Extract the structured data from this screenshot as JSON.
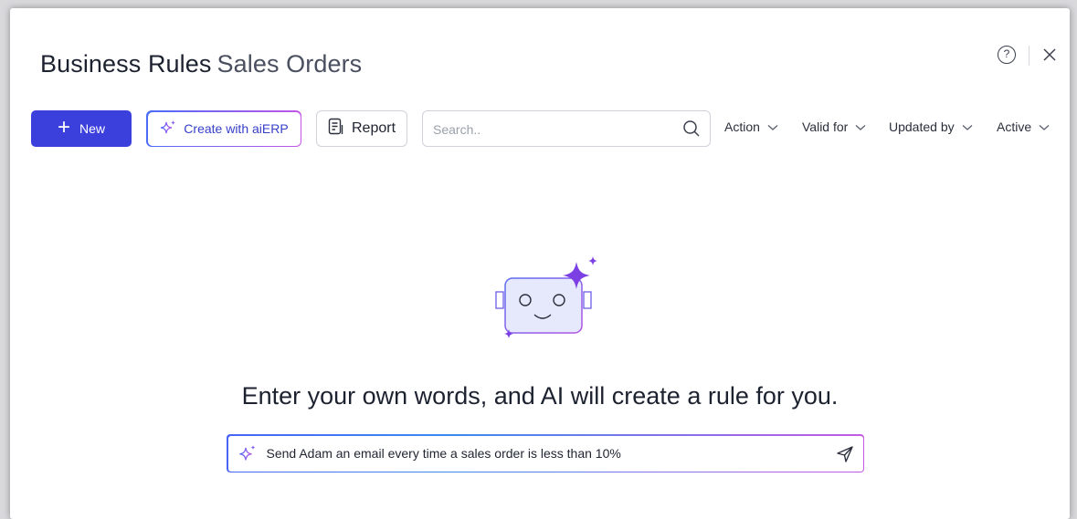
{
  "header": {
    "title": "Business Rules",
    "subtitle": "Sales Orders",
    "help_glyph": "?",
    "icons": [
      "help-icon",
      "close-icon"
    ]
  },
  "toolbar": {
    "new_label": "New",
    "ai_label": "Create with aiERP",
    "report_label": "Report",
    "search_placeholder": "Search..",
    "filters": [
      "Action",
      "Valid for",
      "Updated by",
      "Active"
    ]
  },
  "empty_state": {
    "headline": "Enter your own words, and AI will create a rule for you.",
    "prompt_text": "Send Adam an email every time a sales order is less than 10%"
  },
  "colors": {
    "primary": "#3b3fdc",
    "gradient_start": "#4a6cf7",
    "gradient_end": "#c156e6",
    "robot_fill": "#e6e9fb",
    "robot_accent": "#7b3fe4"
  }
}
